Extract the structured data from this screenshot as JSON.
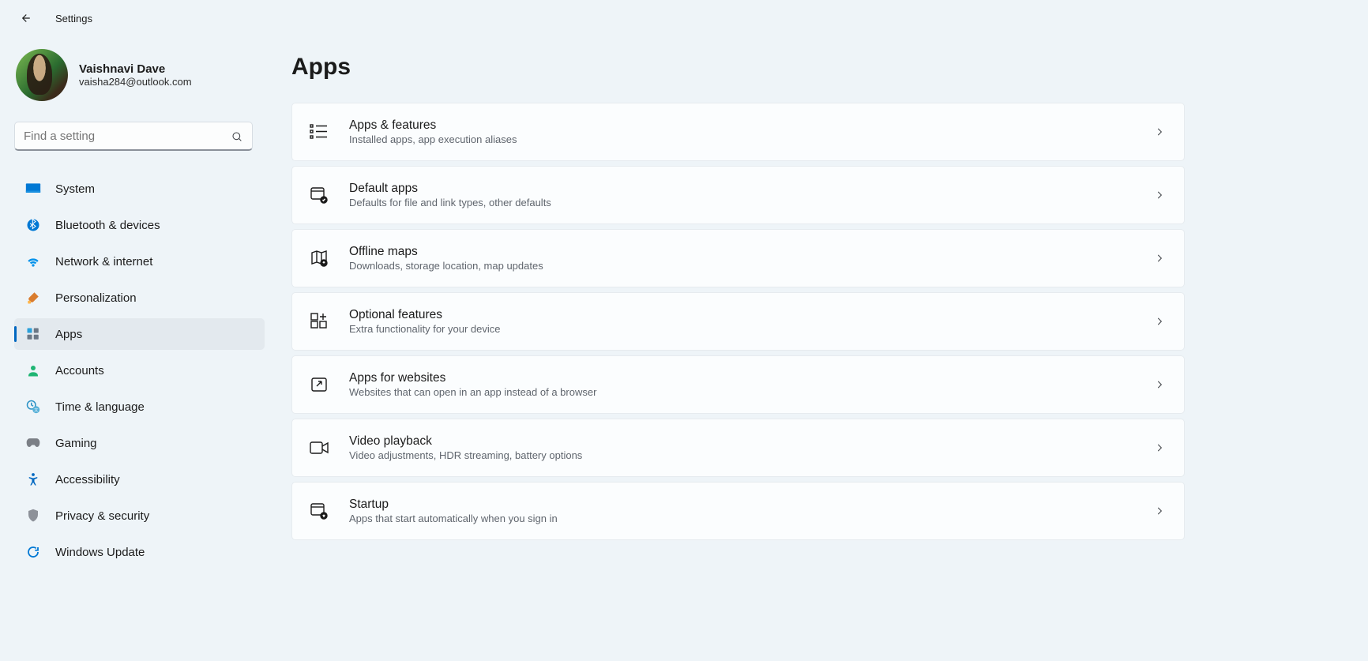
{
  "titlebar": {
    "title": "Settings"
  },
  "profile": {
    "name": "Vaishnavi Dave",
    "email": "vaisha284@outlook.com"
  },
  "search": {
    "placeholder": "Find a setting"
  },
  "nav": [
    {
      "label": "System",
      "icon": "display-icon",
      "active": false
    },
    {
      "label": "Bluetooth & devices",
      "icon": "bluetooth-icon",
      "active": false
    },
    {
      "label": "Network & internet",
      "icon": "wifi-icon",
      "active": false
    },
    {
      "label": "Personalization",
      "icon": "brush-icon",
      "active": false
    },
    {
      "label": "Apps",
      "icon": "apps-icon",
      "active": true
    },
    {
      "label": "Accounts",
      "icon": "account-icon",
      "active": false
    },
    {
      "label": "Time & language",
      "icon": "time-lang-icon",
      "active": false
    },
    {
      "label": "Gaming",
      "icon": "gaming-icon",
      "active": false
    },
    {
      "label": "Accessibility",
      "icon": "accessibility-icon",
      "active": false
    },
    {
      "label": "Privacy & security",
      "icon": "privacy-icon",
      "active": false
    },
    {
      "label": "Windows Update",
      "icon": "update-icon",
      "active": false
    }
  ],
  "page": {
    "title": "Apps",
    "cards": [
      {
        "title": "Apps & features",
        "sub": "Installed apps, app execution aliases",
        "icon": "list-icon"
      },
      {
        "title": "Default apps",
        "sub": "Defaults for file and link types, other defaults",
        "icon": "default-apps-icon"
      },
      {
        "title": "Offline maps",
        "sub": "Downloads, storage location, map updates",
        "icon": "map-icon"
      },
      {
        "title": "Optional features",
        "sub": "Extra functionality for your device",
        "icon": "grid-plus-icon"
      },
      {
        "title": "Apps for websites",
        "sub": "Websites that can open in an app instead of a browser",
        "icon": "open-app-icon"
      },
      {
        "title": "Video playback",
        "sub": "Video adjustments, HDR streaming, battery options",
        "icon": "video-icon"
      },
      {
        "title": "Startup",
        "sub": "Apps that start automatically when you sign in",
        "icon": "startup-icon"
      }
    ]
  }
}
